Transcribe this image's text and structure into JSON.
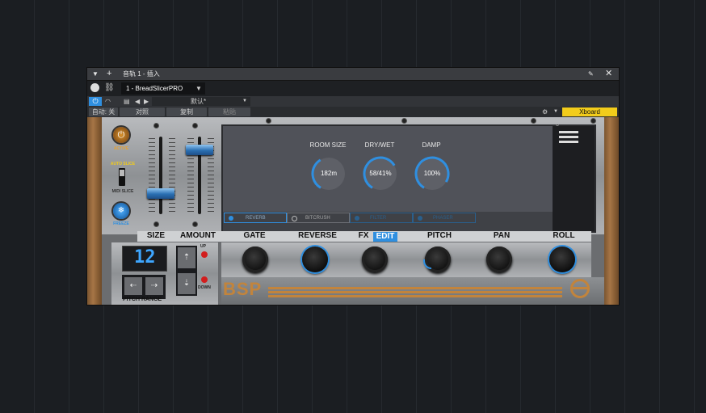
{
  "window": {
    "title": "音轨 1 - 插入",
    "preset_slot": "1 - BreadSlicerPRO",
    "preset_name": "默认*",
    "auto_label": "自动: 关",
    "compare_label": "对照",
    "copy_label": "复制",
    "paste_label": "粘贴",
    "xboard_label": "Xboard"
  },
  "plugin": {
    "active_label": "ACTIVE",
    "auto_slice_label": "AUTO SLICE",
    "midi_slice_label": "MIDI SLICE",
    "freeze_label": "FREEZE",
    "fader_left_level": 0.23,
    "fader_right_level": 0.88,
    "fx_panel": {
      "close_label": "x",
      "knobs": [
        {
          "title": "ROOM SIZE",
          "value": "182m",
          "arc": 0.33
        },
        {
          "title": "DRY/WET",
          "value": "58/41%",
          "arc": 0.58
        },
        {
          "title": "DAMP",
          "value": "100%",
          "arc": 0.75
        }
      ],
      "tabs": [
        "REVERB",
        "BITCRUSH",
        "FILTER",
        "PHASER"
      ]
    },
    "headers": {
      "size": "SIZE",
      "amount": "AMOUNT",
      "gate": "GATE",
      "reverse": "REVERSE",
      "fx": "FX",
      "edit": "EDIT",
      "pitch": "PITCH",
      "pan": "PAN",
      "roll": "ROLL"
    },
    "display_value": "12",
    "up_label": "UP",
    "down_label": "DOWN",
    "pitch_range_label": "PITCH RANGE",
    "logo_text": "BSP",
    "colors": {
      "accent": "#2f8fe0",
      "orange": "#c2843c",
      "xboard": "#f2cc1b"
    }
  }
}
